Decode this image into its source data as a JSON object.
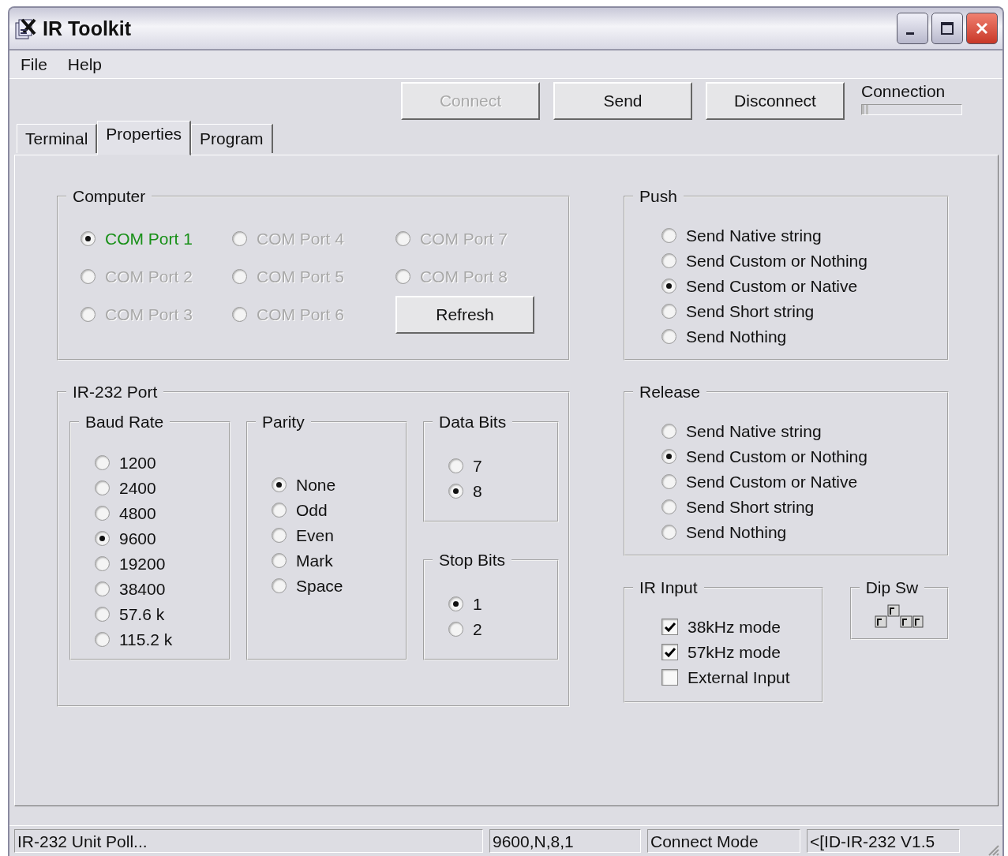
{
  "window": {
    "title": "IR Toolkit"
  },
  "menu": [
    "File",
    "Help"
  ],
  "toolbar": {
    "buttons": [
      {
        "label": "Connect",
        "disabled": true
      },
      {
        "label": "Send",
        "disabled": false
      },
      {
        "label": "Disconnect",
        "disabled": false
      }
    ],
    "connection": {
      "label": "Connection",
      "level": 0.06
    }
  },
  "tabs": [
    {
      "label": "Terminal",
      "selected": false
    },
    {
      "label": "Properties",
      "selected": true
    },
    {
      "label": "Program",
      "selected": false
    }
  ],
  "computer": {
    "title": "Computer",
    "ports": [
      {
        "label": "COM Port 1",
        "selected": true,
        "disabled": false
      },
      {
        "label": "COM Port 4",
        "selected": false,
        "disabled": true
      },
      {
        "label": "COM Port 7",
        "selected": false,
        "disabled": true
      },
      {
        "label": "COM Port 2",
        "selected": false,
        "disabled": true
      },
      {
        "label": "COM Port 5",
        "selected": false,
        "disabled": true
      },
      {
        "label": "COM Port 8",
        "selected": false,
        "disabled": true
      },
      {
        "label": "COM Port 3",
        "selected": false,
        "disabled": true
      },
      {
        "label": "COM Port 6",
        "selected": false,
        "disabled": true
      }
    ],
    "refresh": "Refresh"
  },
  "ir232": {
    "title": "IR-232 Port",
    "groups": [
      {
        "title": "Baud Rate",
        "options": [
          {
            "label": "1200",
            "selected": false
          },
          {
            "label": "2400",
            "selected": false
          },
          {
            "label": "4800",
            "selected": false
          },
          {
            "label": "9600",
            "selected": true
          },
          {
            "label": "19200",
            "selected": false
          },
          {
            "label": "38400",
            "selected": false
          },
          {
            "label": "57.6 k",
            "selected": false
          },
          {
            "label": "115.2 k",
            "selected": false
          }
        ]
      },
      {
        "title": "Parity",
        "options": [
          {
            "label": "None",
            "selected": true
          },
          {
            "label": "Odd",
            "selected": false
          },
          {
            "label": "Even",
            "selected": false
          },
          {
            "label": "Mark",
            "selected": false
          },
          {
            "label": "Space",
            "selected": false
          }
        ]
      },
      {
        "title": "Data Bits",
        "options": [
          {
            "label": "7",
            "selected": false
          },
          {
            "label": "8",
            "selected": true
          }
        ]
      },
      {
        "title": "Stop Bits",
        "options": [
          {
            "label": "1",
            "selected": true
          },
          {
            "label": "2",
            "selected": false
          }
        ]
      }
    ]
  },
  "push": {
    "title": "Push",
    "options": [
      {
        "label": "Send Native string",
        "selected": false
      },
      {
        "label": "Send Custom or Nothing",
        "selected": false
      },
      {
        "label": "Send Custom or Native",
        "selected": true
      },
      {
        "label": "Send Short string",
        "selected": false
      },
      {
        "label": "Send Nothing",
        "selected": false
      }
    ]
  },
  "release": {
    "title": "Release",
    "options": [
      {
        "label": "Send Native string",
        "selected": false
      },
      {
        "label": "Send Custom or Nothing",
        "selected": true
      },
      {
        "label": "Send Custom or Native",
        "selected": false
      },
      {
        "label": "Send Short string",
        "selected": false
      },
      {
        "label": "Send Nothing",
        "selected": false
      }
    ]
  },
  "ir_input": {
    "title": "IR Input",
    "options": [
      {
        "label": "38kHz mode",
        "checked": true
      },
      {
        "label": "57kHz mode",
        "checked": true
      },
      {
        "label": "External Input",
        "checked": false
      }
    ]
  },
  "dip_switch": {
    "title": "Dip Sw"
  },
  "status_bar": [
    "IR-232 Unit Poll...",
    "9600,N,8,1",
    "Connect Mode",
    "<[ID-IR-232 V1.5"
  ]
}
